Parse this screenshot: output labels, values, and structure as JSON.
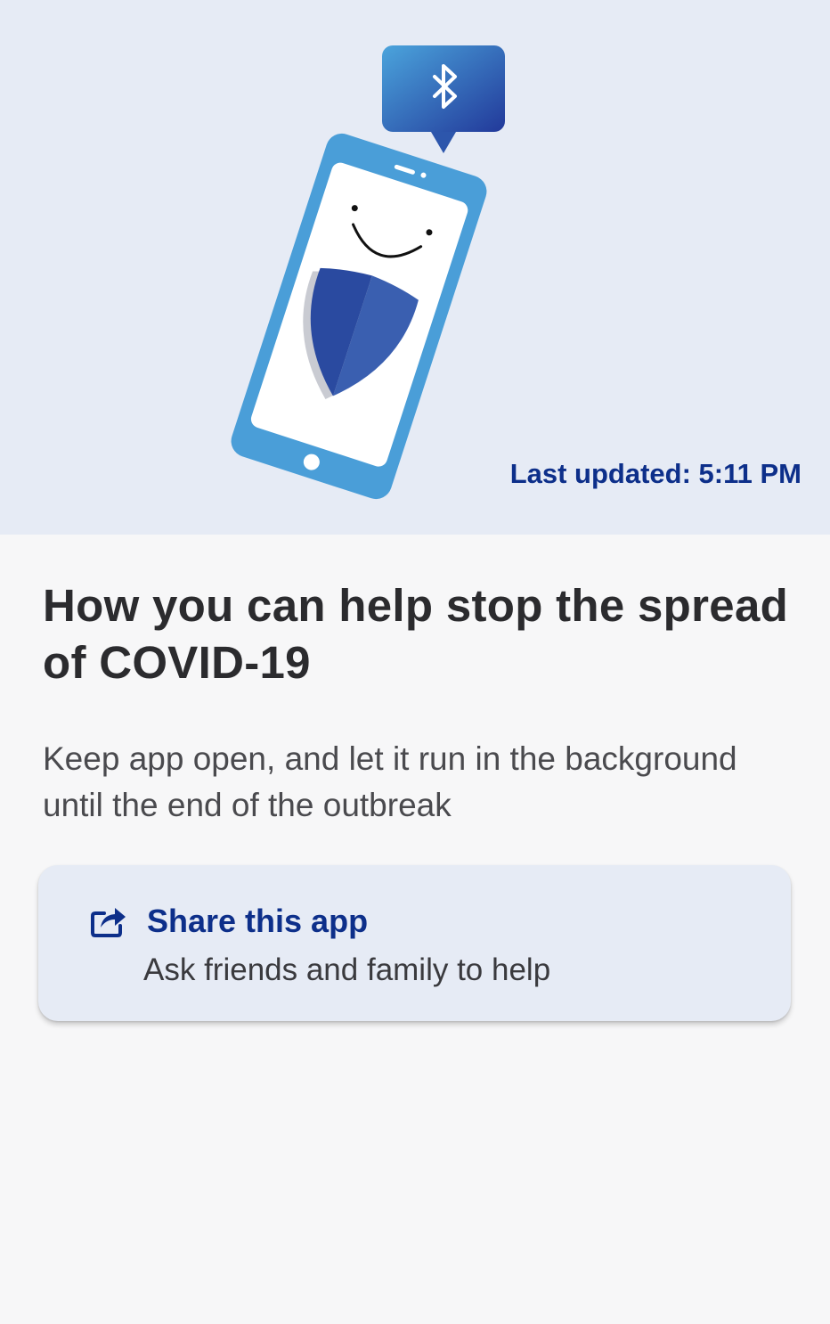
{
  "hero": {
    "last_updated": "Last updated: 5:11 PM",
    "illustration_icons": [
      "phone-icon",
      "bluetooth-icon",
      "shield-icon",
      "smile-face-icon"
    ]
  },
  "main": {
    "headline": "How you can help stop the spread of COVID-19",
    "body": "Keep app open, and let it run in the background until the end of the outbreak"
  },
  "share_card": {
    "title": "Share this app",
    "subtitle": "Ask friends and family to help",
    "icon": "share-icon"
  },
  "colors": {
    "hero_background": "#e6ebf5",
    "accent_blue": "#0d2f8a",
    "phone_blue": "#4a9ed8",
    "shield_dark": "#2a4aa0",
    "shield_light": "#3a5fb0",
    "page_background": "#f7f7f8"
  }
}
